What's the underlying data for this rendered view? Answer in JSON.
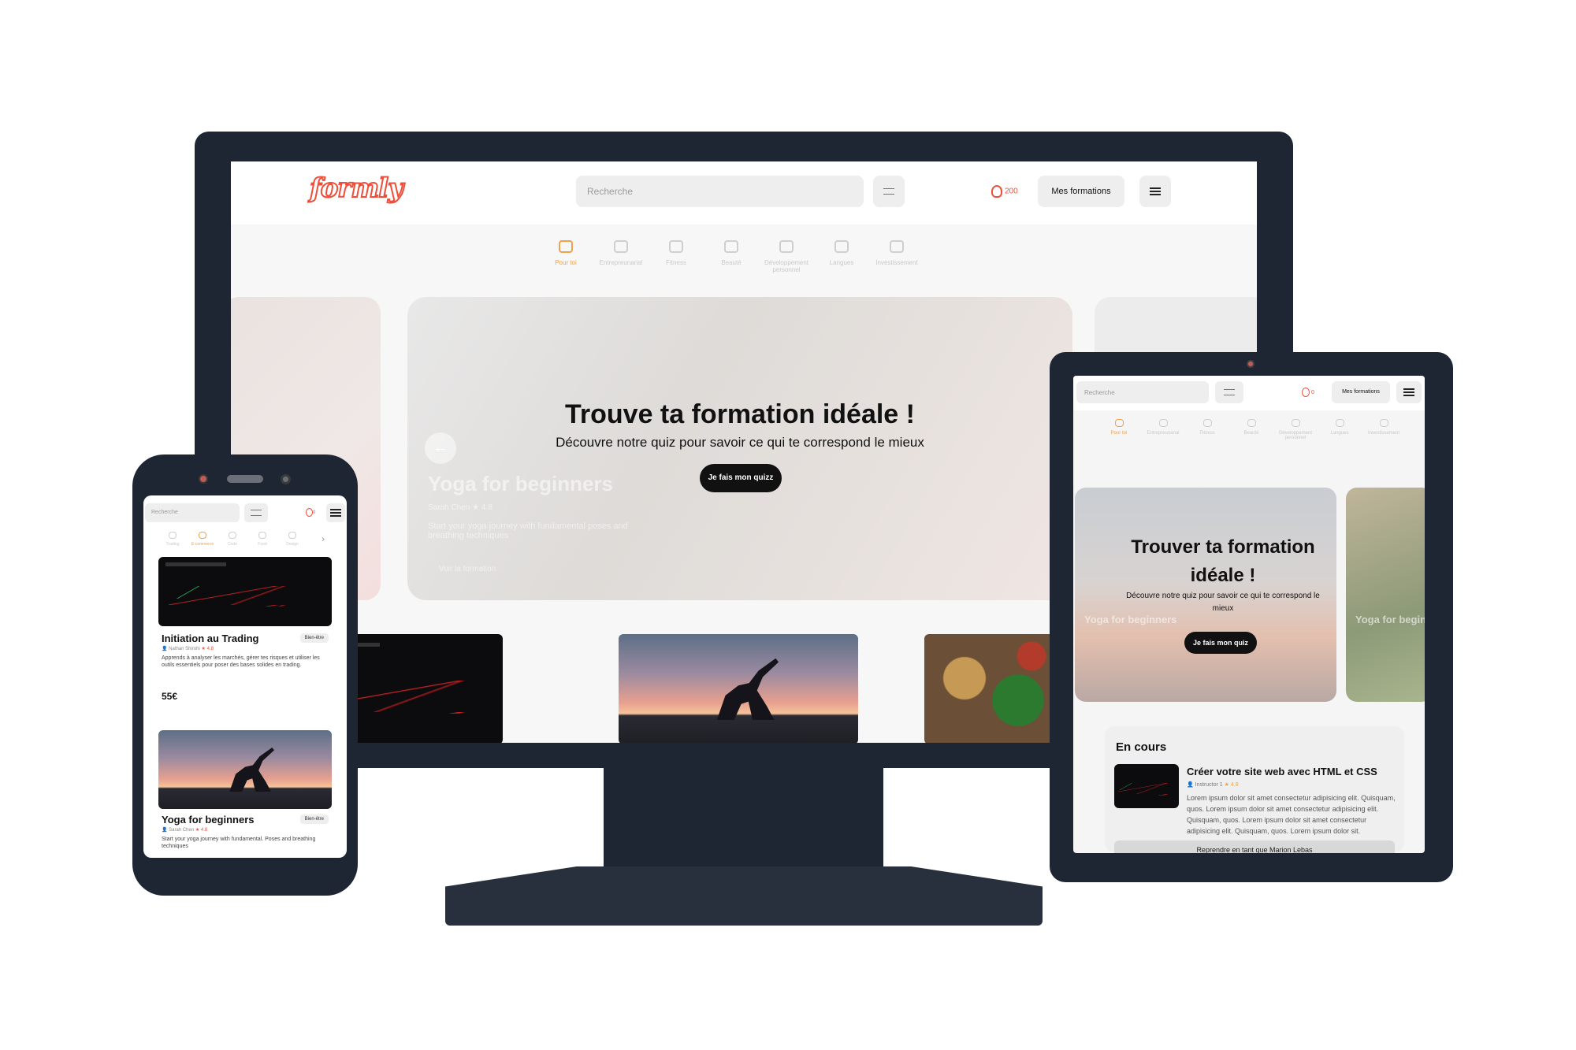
{
  "brand": {
    "name": "formly",
    "color": "#ef4e3a",
    "accent": "#f0a24a"
  },
  "desktop": {
    "search_placeholder": "Recherche",
    "coins": "200",
    "my_courses_label": "Mes formations",
    "categories": [
      {
        "label": "Pour toi",
        "active": true,
        "icon": "chart-icon"
      },
      {
        "label": "Entrepreunarial",
        "active": false,
        "icon": "cart-icon"
      },
      {
        "label": "Fitness",
        "active": false,
        "icon": "pulse-icon"
      },
      {
        "label": "Beauté",
        "active": false,
        "icon": "sparkle-icon"
      },
      {
        "label": "Développement personnel",
        "active": false,
        "icon": "brain-icon"
      },
      {
        "label": "Langues",
        "active": false,
        "icon": "globe-icon"
      },
      {
        "label": "Investissement",
        "active": false,
        "icon": "book-icon"
      }
    ],
    "hero": {
      "quiz_title": "Trouve ta formation idéale !",
      "quiz_subtitle": "Découvre notre quiz pour savoir ce qui te correspond le mieux",
      "quiz_button": "Je fais mon quizz",
      "ghost_title": "Yoga for beginners",
      "ghost_meta": "Sarah Chen  ★ 4.8",
      "ghost_desc": "Start your yoga journey with fundamental poses and breathing techniques",
      "ghost_link": "Voir la formation"
    }
  },
  "tablet": {
    "search_placeholder": "Recherche",
    "coins": "0",
    "my_courses_label": "Mes formations",
    "categories": [
      {
        "label": "Pour toi",
        "active": true
      },
      {
        "label": "Entrepreunarial",
        "active": false
      },
      {
        "label": "Fitness",
        "active": false
      },
      {
        "label": "Beauté",
        "active": false
      },
      {
        "label": "Développement personnel",
        "active": false
      },
      {
        "label": "Langues",
        "active": false
      },
      {
        "label": "Investissement",
        "active": false
      }
    ],
    "hero": {
      "quiz_title": "Trouver ta formation idéale !",
      "quiz_subtitle": "Découvre notre quiz pour savoir ce qui te correspond le mieux",
      "quiz_button": "Je fais mon quiz",
      "ghost_title": "Yoga for beginners",
      "ghost_title_right": "Yoga for begin"
    },
    "in_progress": {
      "heading": "En cours",
      "course_title": "Créer votre site web avec HTML et CSS",
      "instructor": "Instructor 1",
      "rating": "★ 4.8",
      "description": "Lorem ipsum dolor sit amet consectetur adipisicing elit. Quisquam, quos. Lorem ipsum dolor sit amet consectetur adipisicing elit. Quisquam, quos. Lorem ipsum dolor sit amet consectetur adipisicing elit. Quisquam, quos. Lorem ipsum dolor sit.",
      "resume_button": "Reprendre en tant que Marion Lebas"
    }
  },
  "phone": {
    "search_placeholder": "Recherche",
    "coins": "0",
    "categories": [
      {
        "label": "Trading",
        "active": false
      },
      {
        "label": "E-commerce",
        "active": true
      },
      {
        "label": "Code",
        "active": false
      },
      {
        "label": "Food",
        "active": false
      },
      {
        "label": "Design",
        "active": false
      }
    ],
    "cards": [
      {
        "title": "Initiation au Trading",
        "badge": "Bien-être",
        "author": "Nathan Shirohi",
        "rating": "★ 4.8",
        "description": "Apprends à analyser les marchés, gérer tes risques et utiliser les outils essentiels pour poser des bases solides en trading.",
        "price": "55€"
      },
      {
        "title": "Yoga for beginners",
        "badge": "Bien-être",
        "author": "Sarah Chen",
        "rating": "★ 4.8",
        "description": "Start your yoga journey with fundamental. Poses and breathing techniques",
        "price": ""
      }
    ]
  }
}
